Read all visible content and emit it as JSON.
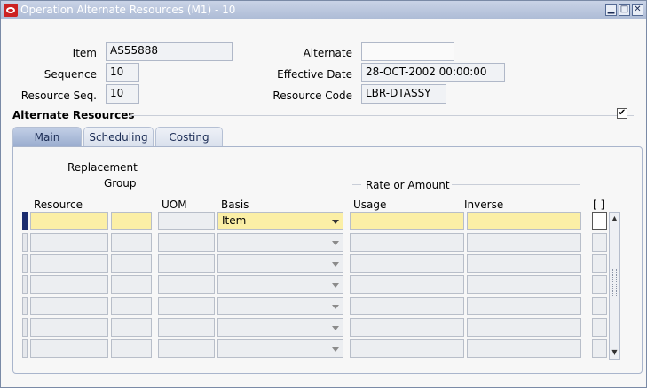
{
  "window": {
    "title": "Operation Alternate Resources (M1) - 10",
    "controls": [
      "minimize-icon",
      "maximize-icon",
      "close-icon"
    ]
  },
  "header": {
    "item_label": "Item",
    "item_value": "AS55888",
    "sequence_label": "Sequence",
    "sequence_value": "10",
    "resource_seq_label": "Resource Seq.",
    "resource_seq_value": "10",
    "alternate_label": "Alternate",
    "alternate_value": "",
    "effective_date_label": "Effective Date",
    "effective_date_value": "28-OCT-2002 00:00:00",
    "resource_code_label": "Resource Code",
    "resource_code_value": "LBR-DTASSY"
  },
  "section": {
    "title": "Alternate Resources",
    "checkbox_checked": true,
    "checkbox_glyph": "✔"
  },
  "tabs": [
    {
      "label": "Main",
      "active": true
    },
    {
      "label": "Scheduling",
      "active": false
    },
    {
      "label": "Costing",
      "active": false
    }
  ],
  "grid": {
    "columns": {
      "resource": "Resource",
      "replacement_group_line1": "Replacement",
      "replacement_group_line2": "Group",
      "uom": "UOM",
      "basis": "Basis",
      "rate_group": "Rate or Amount",
      "usage": "Usage",
      "inverse": "Inverse",
      "flag": "[ ]"
    },
    "rows": [
      {
        "resource": "",
        "replacement_group": "",
        "uom": "",
        "basis": "Item",
        "usage": "",
        "inverse": ""
      },
      {
        "resource": "",
        "replacement_group": "",
        "uom": "",
        "basis": "",
        "usage": "",
        "inverse": ""
      },
      {
        "resource": "",
        "replacement_group": "",
        "uom": "",
        "basis": "",
        "usage": "",
        "inverse": ""
      },
      {
        "resource": "",
        "replacement_group": "",
        "uom": "",
        "basis": "",
        "usage": "",
        "inverse": ""
      },
      {
        "resource": "",
        "replacement_group": "",
        "uom": "",
        "basis": "",
        "usage": "",
        "inverse": ""
      },
      {
        "resource": "",
        "replacement_group": "",
        "uom": "",
        "basis": "",
        "usage": "",
        "inverse": ""
      },
      {
        "resource": "",
        "replacement_group": "",
        "uom": "",
        "basis": "",
        "usage": "",
        "inverse": ""
      }
    ],
    "scroll_up_glyph": "▲",
    "scroll_down_glyph": "▼"
  }
}
